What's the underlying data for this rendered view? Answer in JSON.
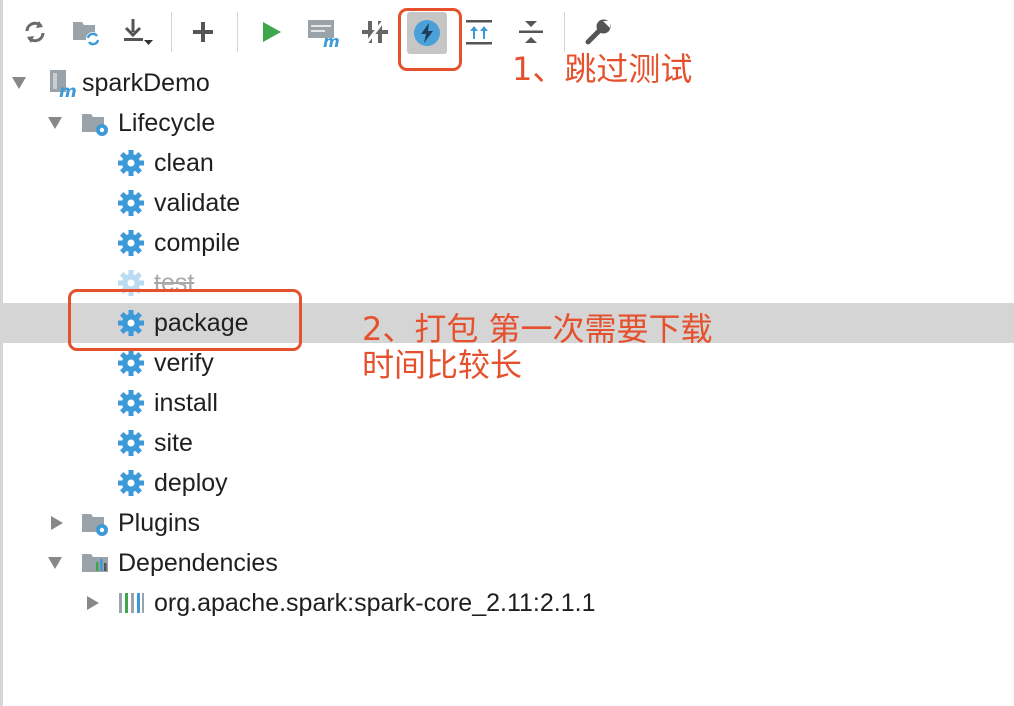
{
  "toolbar": {
    "buttons": [
      {
        "icon": "refresh-icon",
        "tooltip": "Reimport"
      },
      {
        "icon": "folder-sync-icon",
        "tooltip": "Generate Sources"
      },
      {
        "icon": "download-icon",
        "tooltip": "Download Sources"
      },
      {
        "icon": "plus-icon",
        "tooltip": "Add Maven Projects"
      },
      {
        "icon": "run-icon",
        "tooltip": "Run Maven Build"
      },
      {
        "icon": "maven-goal-icon",
        "tooltip": "Execute Maven Goal"
      },
      {
        "icon": "toggle-offline-icon",
        "tooltip": "Toggle Offline Mode"
      },
      {
        "icon": "skip-tests-icon",
        "tooltip": "Toggle Skip Tests Mode",
        "active": true
      },
      {
        "icon": "expand-all-icon",
        "tooltip": "Expand All"
      },
      {
        "icon": "collapse-all-icon",
        "tooltip": "Collapse All"
      },
      {
        "icon": "settings-wrench-icon",
        "tooltip": "Maven Settings"
      }
    ]
  },
  "tree": {
    "project": "sparkDemo",
    "lifecycle": {
      "label": "Lifecycle",
      "goals": [
        "clean",
        "validate",
        "compile",
        "test",
        "package",
        "verify",
        "install",
        "site",
        "deploy"
      ],
      "disabled_goal": "test",
      "selected_goal": "package"
    },
    "plugins": {
      "label": "Plugins"
    },
    "dependencies": {
      "label": "Dependencies",
      "items": [
        "org.apache.spark:spark-core_2.11:2.1.1"
      ]
    }
  },
  "annotations": {
    "note1": "1、跳过测试",
    "note2_line1": "2、打包 第一次需要下载",
    "note2_line2": "时间比较长",
    "color": "#e5502d"
  },
  "colors": {
    "gear": "#3d9ad8",
    "run": "#3fa74b",
    "selection": "#d5d5d5"
  }
}
